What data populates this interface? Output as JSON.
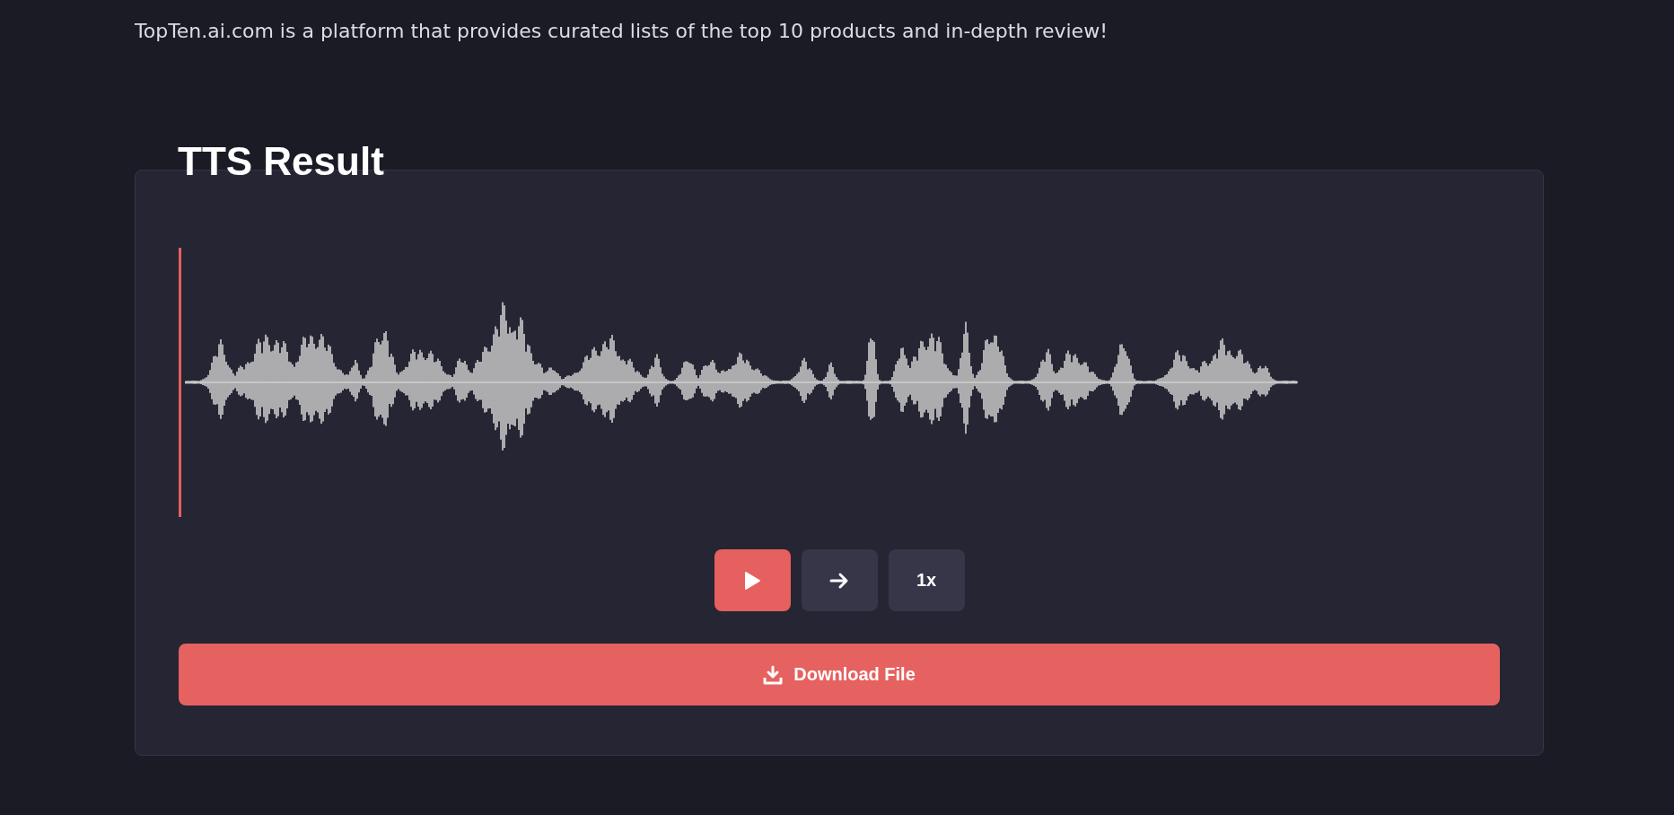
{
  "header": {
    "tagline": "TopTen.ai.com is a platform that provides curated lists of the top 10 products and in-depth review!"
  },
  "card": {
    "title": "TTS Result",
    "controls": [
      {
        "kind": "play"
      },
      {
        "kind": "forward"
      },
      {
        "kind": "speed",
        "label": "1x"
      }
    ],
    "download": {
      "label": "Download File"
    }
  }
}
